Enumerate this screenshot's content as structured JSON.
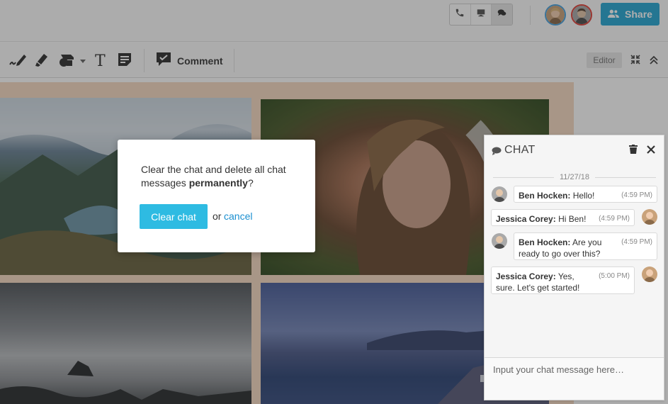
{
  "colors": {
    "accent": "#2aa8d4",
    "clear_button": "#2ebbe2",
    "link": "#1b8fd0",
    "board_background": "#f6dac3"
  },
  "header": {
    "call_buttons": [
      {
        "icon": "phone-icon"
      },
      {
        "icon": "screen-share-icon"
      },
      {
        "icon": "chat-bubbles-icon"
      }
    ],
    "avatars": [
      "jessica-avatar",
      "ben-avatar"
    ],
    "share_label": "Share",
    "share_icon": "users-icon"
  },
  "toolbar": {
    "tools": [
      {
        "icon": "pen-icon"
      },
      {
        "icon": "highlighter-icon"
      },
      {
        "icon": "shapes-icon"
      },
      {
        "icon": "chevron-down-icon"
      },
      {
        "icon": "text-icon"
      },
      {
        "icon": "note-icon"
      }
    ],
    "comment_label": "Comment",
    "editor_label": "Editor",
    "text_tool_glyph": "T"
  },
  "chat": {
    "title": "CHAT",
    "date": "11/27/18",
    "messages": [
      {
        "author": "Ben Hocken:",
        "text": "Hello!",
        "time": "(4:59 PM)"
      },
      {
        "author": "Jessica Corey:",
        "text": "Hi Ben!",
        "time": "(4:59 PM)"
      },
      {
        "author": "Ben Hocken:",
        "text": "Are you ready to go over this?",
        "time": "(4:59 PM)"
      },
      {
        "author": "Jessica Corey:",
        "text": "Yes, sure. Let's get started!",
        "time": "(5:00 PM)"
      }
    ],
    "input_placeholder": "Input your chat message here…"
  },
  "modal": {
    "text_before": "Clear the chat and delete all chat messages ",
    "text_bold": "permanently",
    "text_after": "?",
    "confirm_label": "Clear chat",
    "or_label": "or",
    "cancel_label": "cancel"
  }
}
